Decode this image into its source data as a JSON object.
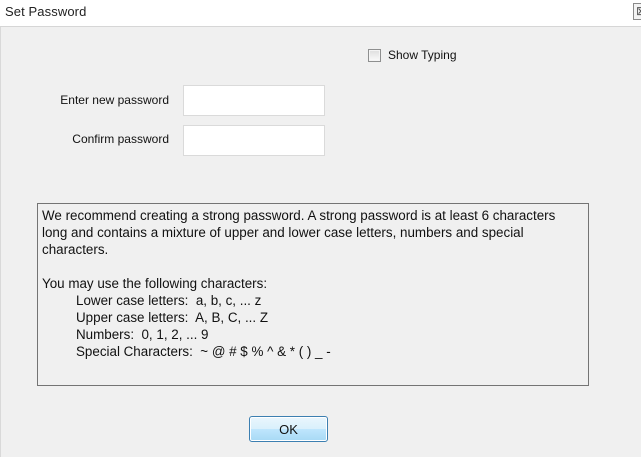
{
  "window": {
    "title": "Set Password",
    "close_glyph": "⊠"
  },
  "show_typing": {
    "label": "Show Typing",
    "checked": false
  },
  "fields": {
    "new_password": {
      "label": "Enter new password",
      "value": ""
    },
    "confirm_password": {
      "label": "Confirm password",
      "value": ""
    }
  },
  "info": {
    "recommendation": "We recommend creating a strong password. A strong password is at least 6 characters long and contains a mixture of upper and lower case letters, numbers and special characters.",
    "allowed_heading": "You may use the following characters:",
    "allowed_lines": [
      "Lower case letters:  a, b, c, ... z",
      "Upper case letters:  A, B, C, ... Z",
      "Numbers:  0, 1, 2, ... 9",
      "Special Characters:  ~ @ # $ % ^ & * ( ) _ -"
    ]
  },
  "buttons": {
    "ok_label": "OK"
  },
  "icons": {
    "close": "close-icon",
    "checkbox": "checkbox-icon"
  }
}
